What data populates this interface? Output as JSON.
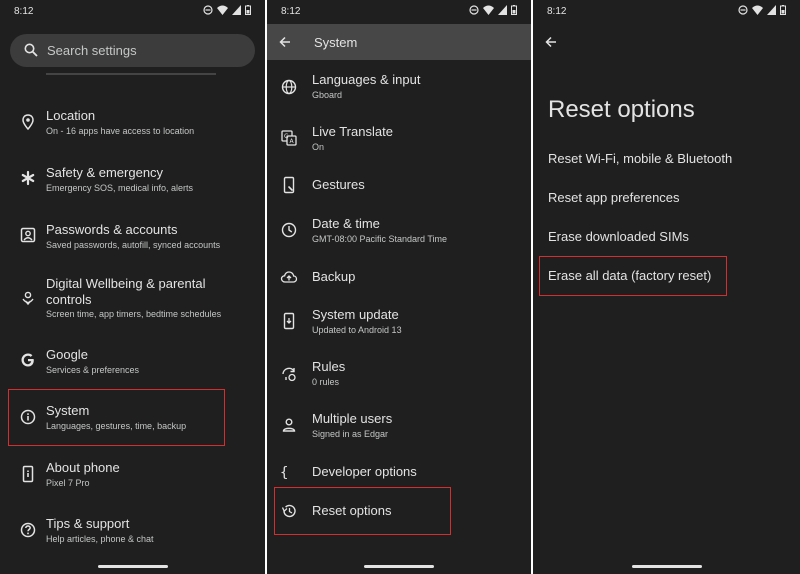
{
  "status_time": "8:12",
  "panel1": {
    "search_placeholder": "Search settings",
    "items": [
      {
        "title": "Location",
        "subtitle": "On - 16 apps have access to location"
      },
      {
        "title": "Safety & emergency",
        "subtitle": "Emergency SOS, medical info, alerts"
      },
      {
        "title": "Passwords & accounts",
        "subtitle": "Saved passwords, autofill, synced accounts"
      },
      {
        "title": "Digital Wellbeing & parental",
        "title_line2": "controls",
        "subtitle": "Screen time, app timers, bedtime schedules"
      },
      {
        "title": "Google",
        "subtitle": "Services & preferences"
      },
      {
        "title": "System",
        "subtitle": "Languages, gestures, time, backup"
      },
      {
        "title": "About phone",
        "subtitle": "Pixel 7 Pro"
      },
      {
        "title": "Tips & support",
        "subtitle": "Help articles, phone & chat"
      }
    ]
  },
  "panel2": {
    "title": "System",
    "items": [
      {
        "title": "Languages & input",
        "subtitle": "Gboard"
      },
      {
        "title": "Live Translate",
        "subtitle": "On"
      },
      {
        "title": "Gestures",
        "subtitle": ""
      },
      {
        "title": "Date & time",
        "subtitle": "GMT-08:00 Pacific Standard Time"
      },
      {
        "title": "Backup",
        "subtitle": ""
      },
      {
        "title": "System update",
        "subtitle": "Updated to Android 13"
      },
      {
        "title": "Rules",
        "subtitle": "0 rules"
      },
      {
        "title": "Multiple users",
        "subtitle": "Signed in as Edgar"
      },
      {
        "title": "Developer options",
        "subtitle": ""
      },
      {
        "title": "Reset options",
        "subtitle": ""
      }
    ]
  },
  "panel3": {
    "title": "Reset options",
    "options": [
      "Reset Wi-Fi, mobile & Bluetooth",
      "Reset app preferences",
      "Erase downloaded SIMs",
      "Erase all data (factory reset)"
    ]
  },
  "colors": {
    "background": "#1f1f1f",
    "highlight": "#d32f2f",
    "text": "#e3e3e3",
    "subtext": "#c4c7c5",
    "appbar": "#474747"
  }
}
